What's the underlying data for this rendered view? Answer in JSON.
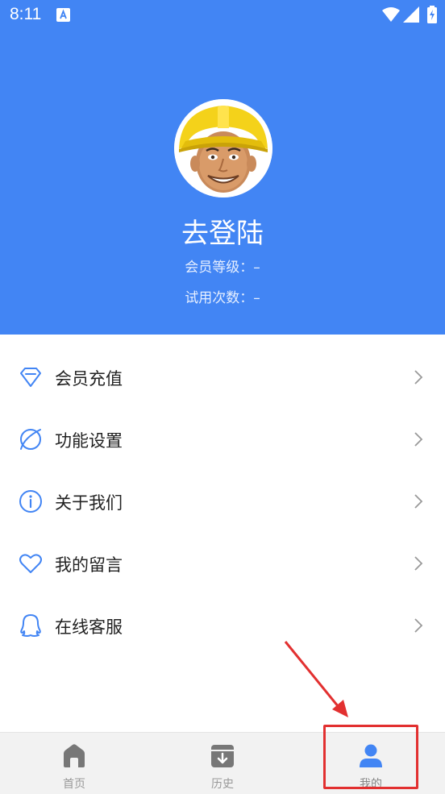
{
  "status_bar": {
    "time": "8:11"
  },
  "profile": {
    "name": "去登陆",
    "member_level": "会员等级：–",
    "trial_count": "试用次数：–"
  },
  "menu": [
    {
      "label": "会员充值",
      "icon": "diamond-icon"
    },
    {
      "label": "功能设置",
      "icon": "leaf-icon"
    },
    {
      "label": "关于我们",
      "icon": "info-icon"
    },
    {
      "label": "我的留言",
      "icon": "heart-icon"
    },
    {
      "label": "在线客服",
      "icon": "qq-icon"
    }
  ],
  "bottom_nav": [
    {
      "label": "首页",
      "icon": "home-icon",
      "active": false
    },
    {
      "label": "历史",
      "icon": "history-box-icon",
      "active": false
    },
    {
      "label": "我的",
      "icon": "person-icon",
      "active": true
    }
  ],
  "colors": {
    "primary": "#4285F4",
    "annotation": "#e23030"
  }
}
